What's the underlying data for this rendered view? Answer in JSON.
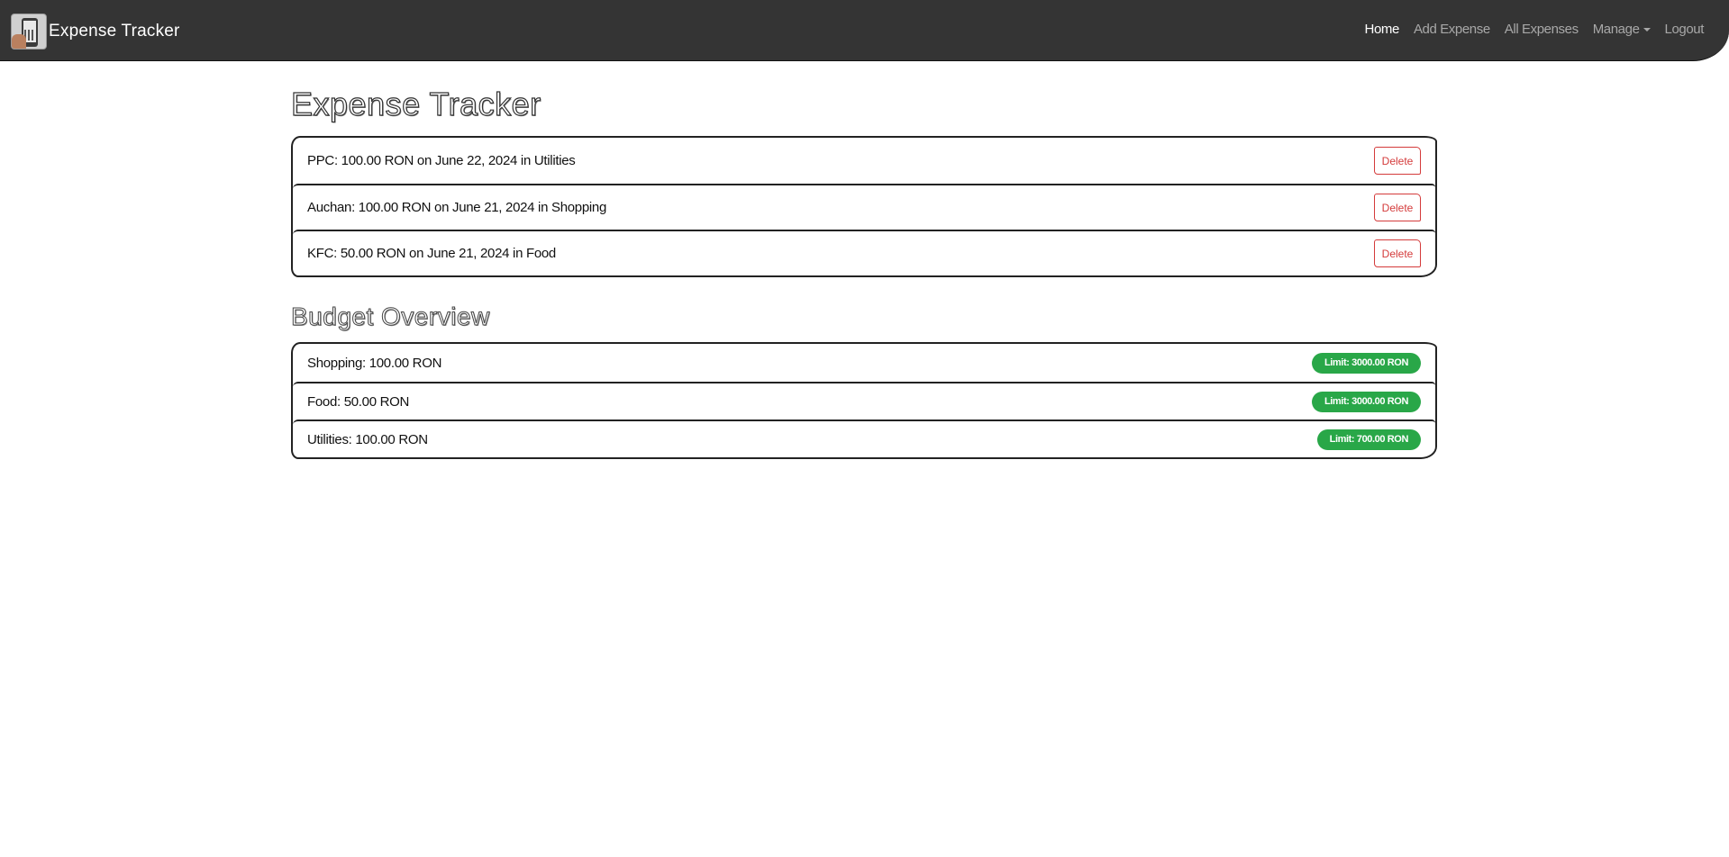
{
  "navbar": {
    "brand": "Expense Tracker",
    "links": {
      "home": "Home",
      "add_expense": "Add Expense",
      "all_expenses": "All Expenses",
      "manage": "Manage",
      "logout": "Logout"
    }
  },
  "main": {
    "title": "Expense Tracker",
    "expenses": [
      {
        "text": "PPC: 100.00 RON on June 22, 2024 in Utilities",
        "action": "Delete"
      },
      {
        "text": "Auchan: 100.00 RON on June 21, 2024 in Shopping",
        "action": "Delete"
      },
      {
        "text": "KFC: 50.00 RON on June 21, 2024 in Food",
        "action": "Delete"
      }
    ],
    "budget_title": "Budget Overview",
    "budgets": [
      {
        "text": "Shopping: 100.00 RON",
        "limit": "Limit: 3000.00 RON"
      },
      {
        "text": "Food: 50.00 RON",
        "limit": "Limit: 3000.00 RON"
      },
      {
        "text": "Utilities: 100.00 RON",
        "limit": "Limit: 700.00 RON"
      }
    ]
  },
  "colors": {
    "navbar_bg": "#343434",
    "delete_red": "#d43b3b",
    "badge_green": "#29a748"
  }
}
